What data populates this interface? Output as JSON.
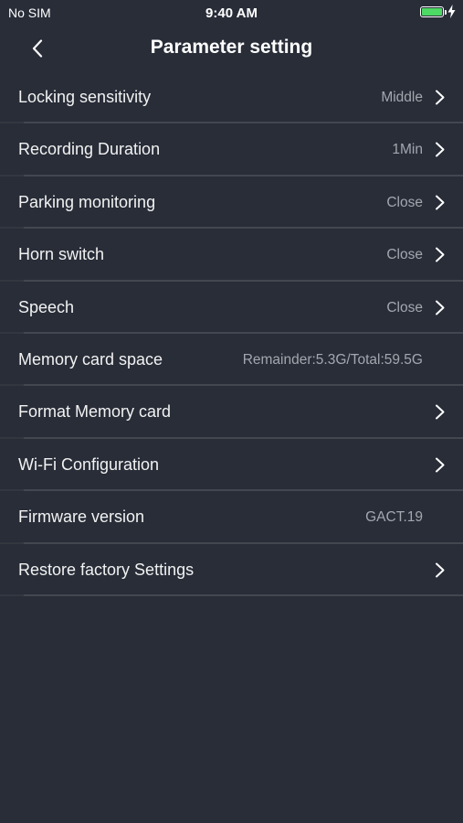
{
  "status_bar": {
    "carrier": "No SIM",
    "time": "9:40 AM",
    "battery_color": "#4cd964"
  },
  "nav": {
    "title": "Parameter setting",
    "back_icon": "chevron-left-icon"
  },
  "settings": [
    {
      "label": "Locking sensitivity",
      "value": "Middle"
    },
    {
      "label": "Recording Duration",
      "value": "1Min"
    },
    {
      "label": "Parking monitoring",
      "value": "Close"
    },
    {
      "label": "Horn switch",
      "value": "Close"
    },
    {
      "label": "Speech",
      "value": "Close"
    },
    {
      "label": "Memory card space",
      "value": "Remainder:5.3G/Total:59.5G"
    },
    {
      "label": "Format Memory card",
      "value": ""
    },
    {
      "label": "Wi-Fi Configuration",
      "value": ""
    },
    {
      "label": "Firmware version",
      "value": "GACT.19"
    },
    {
      "label": "Restore factory Settings",
      "value": ""
    }
  ],
  "colors": {
    "background": "#282d38",
    "divider": "#43474f",
    "value_text": "#a3a7ae"
  }
}
